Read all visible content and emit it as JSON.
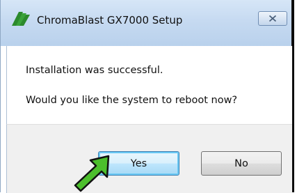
{
  "window": {
    "title": "ChromaBlast GX7000 Setup",
    "close_label": "✕"
  },
  "dialog": {
    "message_line1": "Installation was successful.",
    "message_line2": "Would you like the system to reboot now?"
  },
  "buttons": {
    "yes_label": "Yes",
    "no_label": "No"
  },
  "icons": {
    "app": "chromablast-logo-icon",
    "close": "close-icon",
    "pointer": "green-arrow-icon"
  },
  "colors": {
    "logo_green": "#2c8a2c",
    "arrow_green": "#4cbf2c",
    "default_button_border": "#3c7fb1"
  }
}
